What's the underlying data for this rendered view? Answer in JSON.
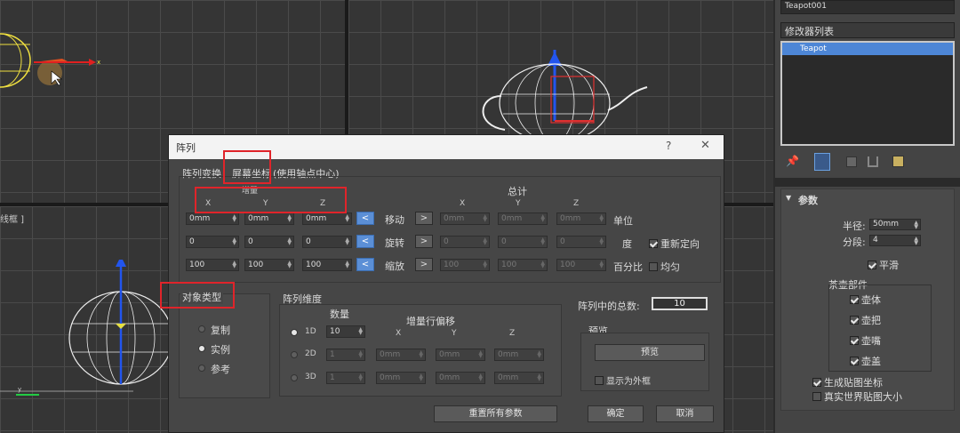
{
  "right_panel": {
    "object_name": "Teapot001",
    "modifier_list_label": "修改器列表",
    "modifier_stack": [
      "Teapot"
    ],
    "rollout_title": "参数",
    "radius_label": "半径:",
    "radius_value": "50mm",
    "segments_label": "分段:",
    "segments_value": "4",
    "smooth_label": "平滑",
    "teapot_parts_label": "茶壶部件",
    "parts": [
      "壶体",
      "壶把",
      "壶嘴",
      "壶盖"
    ],
    "gen_mapping_label": "生成贴图坐标",
    "real_world_label": "真实世界贴图大小"
  },
  "viewport": {
    "label_fragment": "线框 ]"
  },
  "dialog": {
    "title": "阵列",
    "help_glyph": "?",
    "close_glyph": "✕",
    "array_transform_label": "阵列变换",
    "screen_coords_label": "屏幕坐标",
    "use_pivot_label": "(使用轴点中心)",
    "increment_header": "增量",
    "total_header": "总计",
    "axes": [
      "X",
      "Y",
      "Z"
    ],
    "rows": [
      {
        "label": "移动",
        "inc": [
          "0mm",
          "0mm",
          "0mm"
        ],
        "total": [
          "0mm",
          "0mm",
          "0mm"
        ],
        "unit": "单位",
        "option": ""
      },
      {
        "label": "旋转",
        "inc": [
          "0",
          "0",
          "0"
        ],
        "total": [
          "0",
          "0",
          "0"
        ],
        "unit": "度",
        "option": "重新定向"
      },
      {
        "label": "缩放",
        "inc": [
          "100",
          "100",
          "100"
        ],
        "total": [
          "100",
          "100",
          "100"
        ],
        "unit": "百分比",
        "option": "均匀"
      }
    ],
    "arrow_left": "<",
    "arrow_right": ">",
    "object_type_label": "对象类型",
    "object_types": [
      "复制",
      "实例",
      "参考"
    ],
    "object_type_selected": "实例",
    "array_dims_label": "阵列维度",
    "count_header": "数量",
    "offset_header": "增量行偏移",
    "dims": [
      {
        "label": "1D",
        "count": "10",
        "offsets": [],
        "selected": true
      },
      {
        "label": "2D",
        "count": "1",
        "offsets": [
          "0mm",
          "0mm",
          "0mm"
        ],
        "selected": false
      },
      {
        "label": "3D",
        "count": "1",
        "offsets": [
          "0mm",
          "0mm",
          "0mm"
        ],
        "selected": false
      }
    ],
    "total_in_array_label": "阵列中的总数:",
    "total_in_array_value": "10",
    "preview_group_label": "预览",
    "preview_button": "预览",
    "show_as_box_label": "显示为外框",
    "reset_all_button": "重置所有参数",
    "ok_button": "确定",
    "cancel_button": "取消"
  },
  "colors": {
    "accent_blue": "#5b8fd6",
    "highlight_red": "#e0242a",
    "modifier_selected": "#4d86d6"
  }
}
